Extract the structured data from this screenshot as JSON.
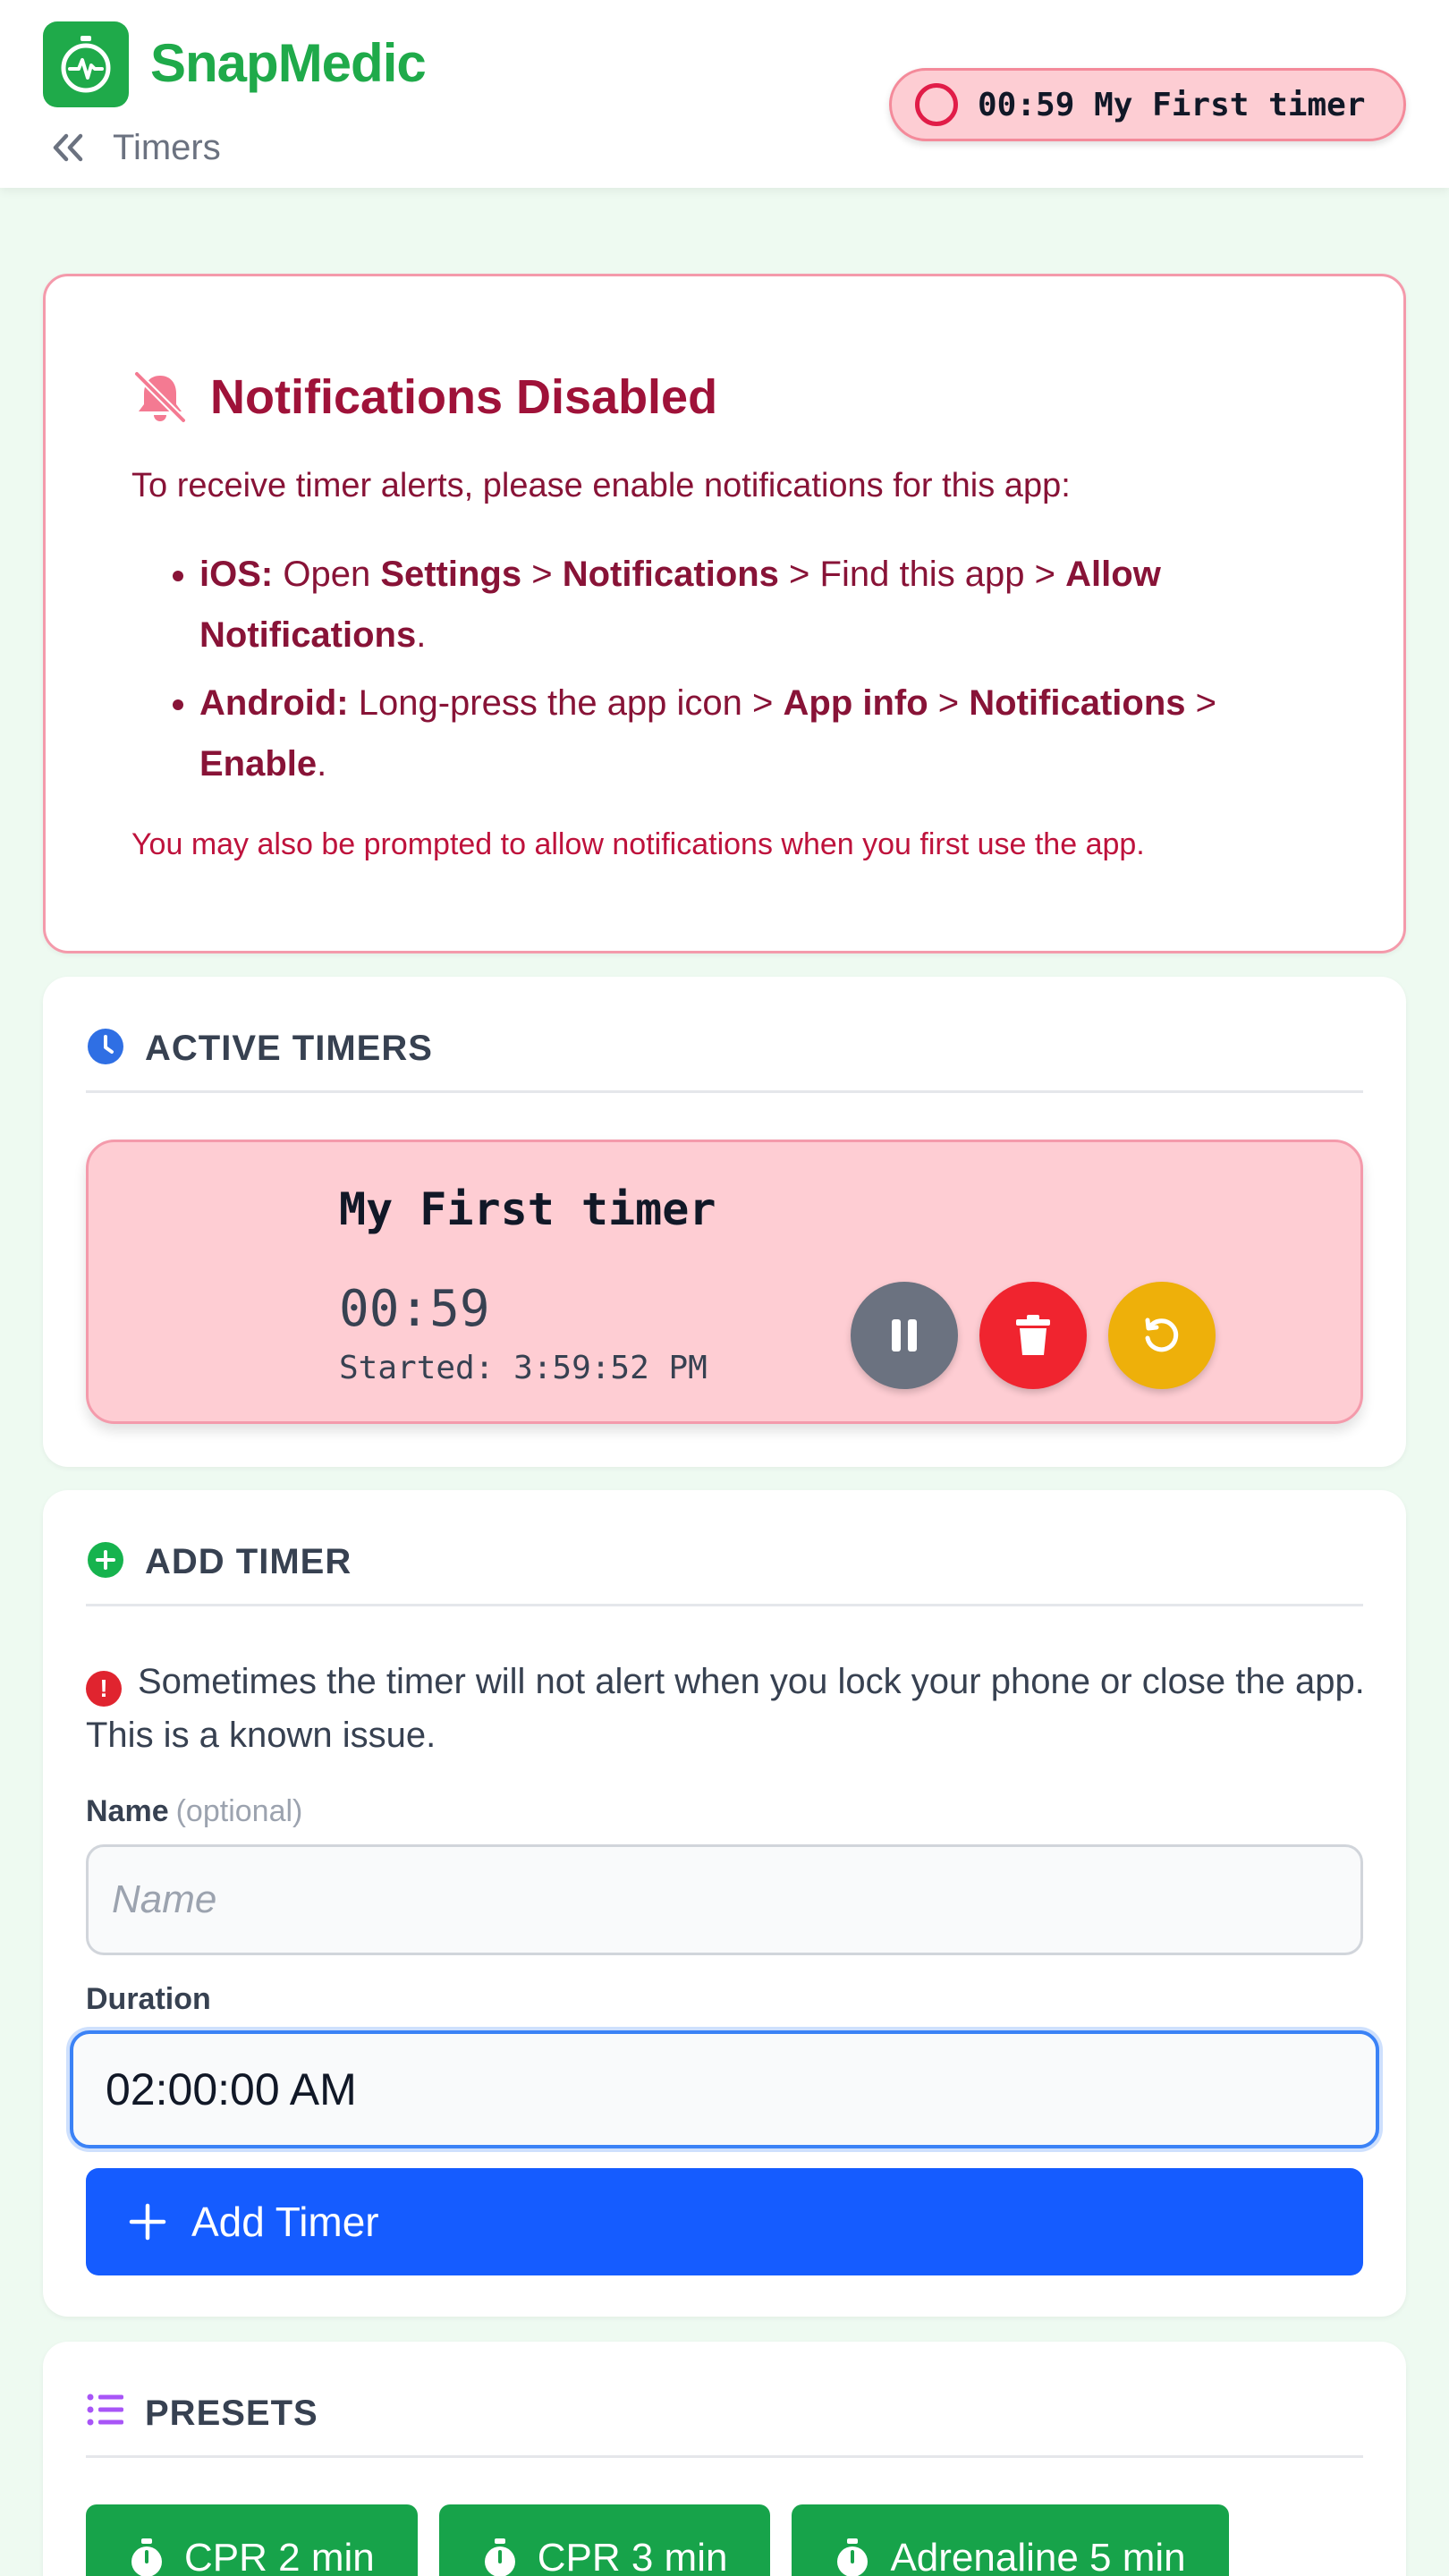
{
  "app": {
    "name": "SnapMedic",
    "logo_icon": "stopwatch-heartbeat-icon"
  },
  "nav": {
    "back_label": "Timers"
  },
  "status_pill": {
    "time": "00:59",
    "name": "My First timer"
  },
  "notifications": {
    "title": "Notifications Disabled",
    "intro": "To receive timer alerts, please enable notifications for this app:",
    "ios": {
      "label": "iOS:",
      "t1": " Open ",
      "b1": "Settings",
      "t2": " > ",
      "b2": "Notifications",
      "t3": " > Find this app > ",
      "b3": "Allow Notifications",
      "t4": "."
    },
    "android": {
      "label": "Android:",
      "t1": " Long-press the app icon > ",
      "b1": "App info",
      "t2": " > ",
      "b2": "Notifications",
      "t3": " > ",
      "b3": "Enable",
      "t4": "."
    },
    "note": "You may also be prompted to allow notifications when you first use the app."
  },
  "active_timers": {
    "title": "ACTIVE TIMERS",
    "items": [
      {
        "name": "My First timer",
        "remaining": "00:59",
        "started": "Started: 3:59:52 PM"
      }
    ]
  },
  "add_timer": {
    "title": "ADD TIMER",
    "warning": "Sometimes the timer will not alert when you lock your phone or close the app. This is a known issue.",
    "name_label": "Name",
    "name_optional": "(optional)",
    "name_placeholder": "Name",
    "duration_label": "Duration",
    "duration_value": "02:00:00 AM",
    "button_label": "Add Timer"
  },
  "presets": {
    "title": "PRESETS",
    "items": [
      "CPR 2 min",
      "CPR 3 min",
      "Adrenaline 5 min"
    ]
  },
  "colors": {
    "brand": "#1faa4a",
    "primary_button": "#155cff",
    "danger": "#f0242f",
    "warning": "#eeb00a",
    "neutral": "#6b7280"
  }
}
